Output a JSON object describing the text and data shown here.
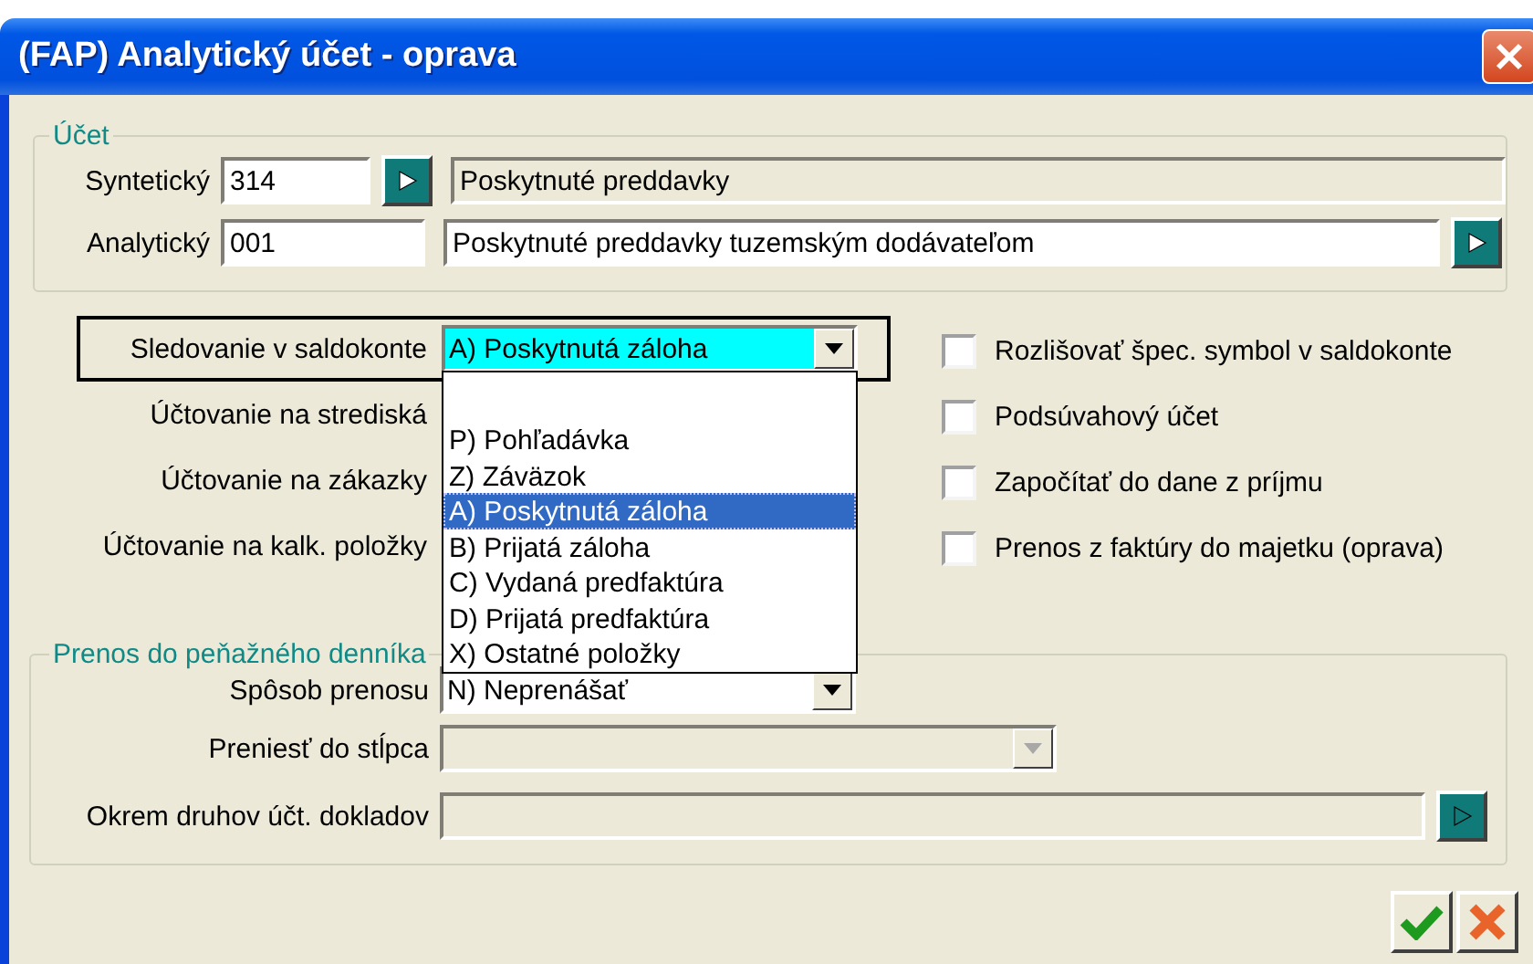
{
  "window": {
    "title": "(FAP) Analytický účet - oprava"
  },
  "account_group": {
    "legend": "Účet",
    "synthetic": {
      "label": "Syntetický",
      "value": "314",
      "name": "Poskytnuté preddavky"
    },
    "analytic": {
      "label": "Analytický",
      "value": "001",
      "name": "Poskytnuté preddavky tuzemským dodávateľom"
    }
  },
  "tracking": {
    "label": "Sledovanie v saldokonte",
    "value": "A) Poskytnutá záloha",
    "expanded": true,
    "options": [
      {
        "label": "P) Pohľadávka",
        "selected": false
      },
      {
        "label": "Z) Záväzok",
        "selected": false
      },
      {
        "label": "A) Poskytnutá záloha",
        "selected": true
      },
      {
        "label": "B) Prijatá záloha",
        "selected": false
      },
      {
        "label": "C) Vydaná predfaktúra",
        "selected": false
      },
      {
        "label": "D) Prijatá predfaktúra",
        "selected": false
      },
      {
        "label": "X) Ostatné položky",
        "selected": false
      }
    ]
  },
  "labels": [
    "Účtovanie na strediská",
    "Účtovanie na zákazky",
    "Účtovanie na kalk. položky"
  ],
  "checkboxes": [
    {
      "label": "Rozlišovať špec. symbol v saldokonte",
      "checked": false
    },
    {
      "label": "Podsúvahový účet",
      "checked": false
    },
    {
      "label": "Započítať do dane z príjmu",
      "checked": false
    },
    {
      "label": "Prenos z faktúry do majetku (oprava)",
      "checked": false
    }
  ],
  "transfer_group": {
    "legend": "Prenos do peňažného denníka",
    "method": {
      "label": "Spôsob prenosu",
      "value": "N) Neprenášať"
    },
    "column": {
      "label": "Preniesť do stĺpca",
      "disabled": true
    },
    "excluded": {
      "label": "Okrem druhov účt. dokladov"
    }
  }
}
